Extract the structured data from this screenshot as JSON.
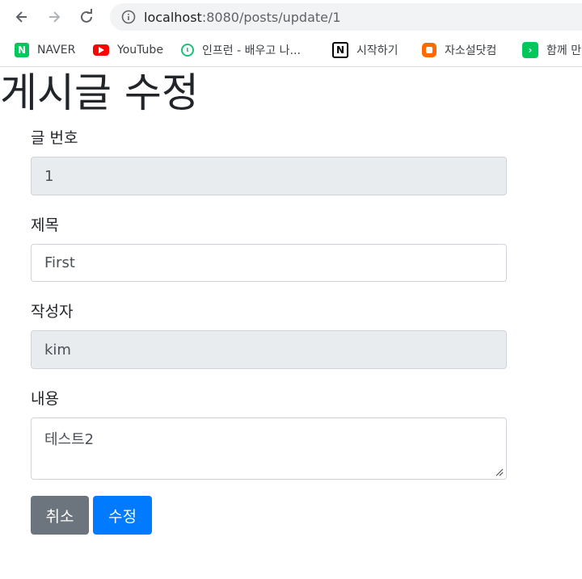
{
  "browser": {
    "url_host": "localhost",
    "url_path": ":8080/posts/update/1",
    "bookmarks": [
      {
        "label": "NAVER",
        "icon": "naver-icon",
        "color": "#03c75a"
      },
      {
        "label": "YouTube",
        "icon": "youtube-icon",
        "color": "#ff0000"
      },
      {
        "label": "인프런 - 배우고 나...",
        "icon": "inflearn-icon",
        "color": "#1dc078"
      },
      {
        "label": "시작하기",
        "icon": "notion-icon",
        "color": "#000000"
      },
      {
        "label": "자소설닷컴",
        "icon": "jasoseol-icon",
        "color": "#ff6a00"
      },
      {
        "label": "함께 만",
        "icon": "green-arrow-icon",
        "color": "#03c75a"
      }
    ]
  },
  "page": {
    "title": "게시글 수정",
    "fields": {
      "id": {
        "label": "글 번호",
        "value": "1"
      },
      "title": {
        "label": "제목",
        "value": "First"
      },
      "author": {
        "label": "작성자",
        "value": "kim"
      },
      "content": {
        "label": "내용",
        "value": "테스트2"
      }
    },
    "buttons": {
      "cancel": "취소",
      "submit": "수정"
    }
  },
  "colors": {
    "cancel": "#6c757d",
    "submit": "#007bff",
    "readonly_bg": "#e9ecef"
  }
}
